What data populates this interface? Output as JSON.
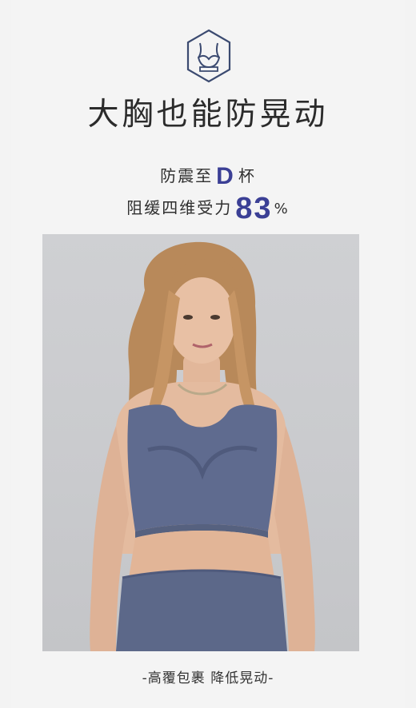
{
  "header": {
    "icon": "sports-bra-hexagon-icon",
    "headline": "大胸也能防晃动"
  },
  "specs": {
    "line1_prefix": "防震至",
    "line1_accent": "D",
    "line1_suffix": "杯",
    "line2_prefix": "阻缓四维受力",
    "line2_accent": "83",
    "line2_suffix": "%"
  },
  "photo": {
    "subject": "model-wearing-blue-gray-sports-bra"
  },
  "caption": {
    "text": "-高覆包裹 降低晃动-"
  },
  "colors": {
    "accent": "#3b3f95",
    "garment": "#5f6b8f",
    "background": "#f3f3f3"
  }
}
